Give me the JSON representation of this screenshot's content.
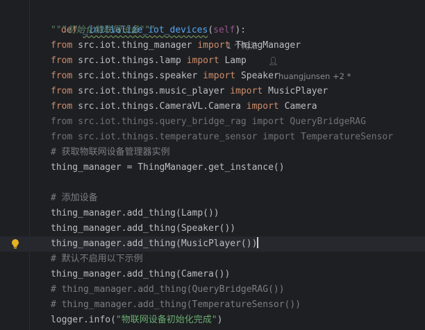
{
  "editor": {
    "def_keyword": "def",
    "function_name": "_initialize_iot_devices",
    "params_open": "(",
    "self_param": "self",
    "params_close": "):",
    "usage_hint": "1 个用法",
    "author_hint": "huangjunsen +2 *",
    "docstring": "\"\"\"初始化物联网设备\"\"\"",
    "imports": [
      {
        "from": "from",
        "module": "src.iot.thing_manager",
        "import": "import",
        "name": "ThingManager"
      },
      {
        "from": "from",
        "module": "src.iot.things.lamp",
        "import": "import",
        "name": "Lamp"
      },
      {
        "from": "from",
        "module": "src.iot.things.speaker",
        "import": "import",
        "name": "Speaker"
      },
      {
        "from": "from",
        "module": "src.iot.things.music_player",
        "import": "import",
        "name": "MusicPlayer"
      },
      {
        "from": "from",
        "module": "src.iot.things.CameraVL.Camera",
        "import": "import",
        "name": "Camera"
      }
    ],
    "unused_imports": [
      "from src.iot.things.query_bridge_rag import QueryBridgeRAG",
      "from src.iot.things.temperature_sensor import TemperatureSensor"
    ],
    "comment_get_manager": "# 获取物联网设备管理器实例",
    "get_instance_line": "thing_manager = ThingManager.get_instance()",
    "comment_add": "# 添加设备",
    "add_lamp": "thing_manager.add_thing(Lamp())",
    "add_speaker": "thing_manager.add_thing(Speaker())",
    "add_music_player": "thing_manager.add_thing(MusicPlayer())",
    "comment_default_off": "# 默认不启用以下示例",
    "add_camera": "thing_manager.add_thing(Camera())",
    "comment_query_bridge": "# thing_manager.add_thing(QueryBridgeRAG())",
    "comment_temperature": "# thing_manager.add_thing(TemperatureSensor())",
    "logger_call": "logger.info(",
    "logger_message": "\"物联网设备初始化完成\"",
    "logger_close": ")",
    "bulb_icon": "lightbulb-icon",
    "colors": {
      "background": "#1e1f22",
      "keyword": "#cf8e6d",
      "function": "#56a8f5",
      "docstring": "#5f826b",
      "comment": "#7a7e85",
      "string": "#6aab73",
      "text": "#bcbec4"
    }
  }
}
